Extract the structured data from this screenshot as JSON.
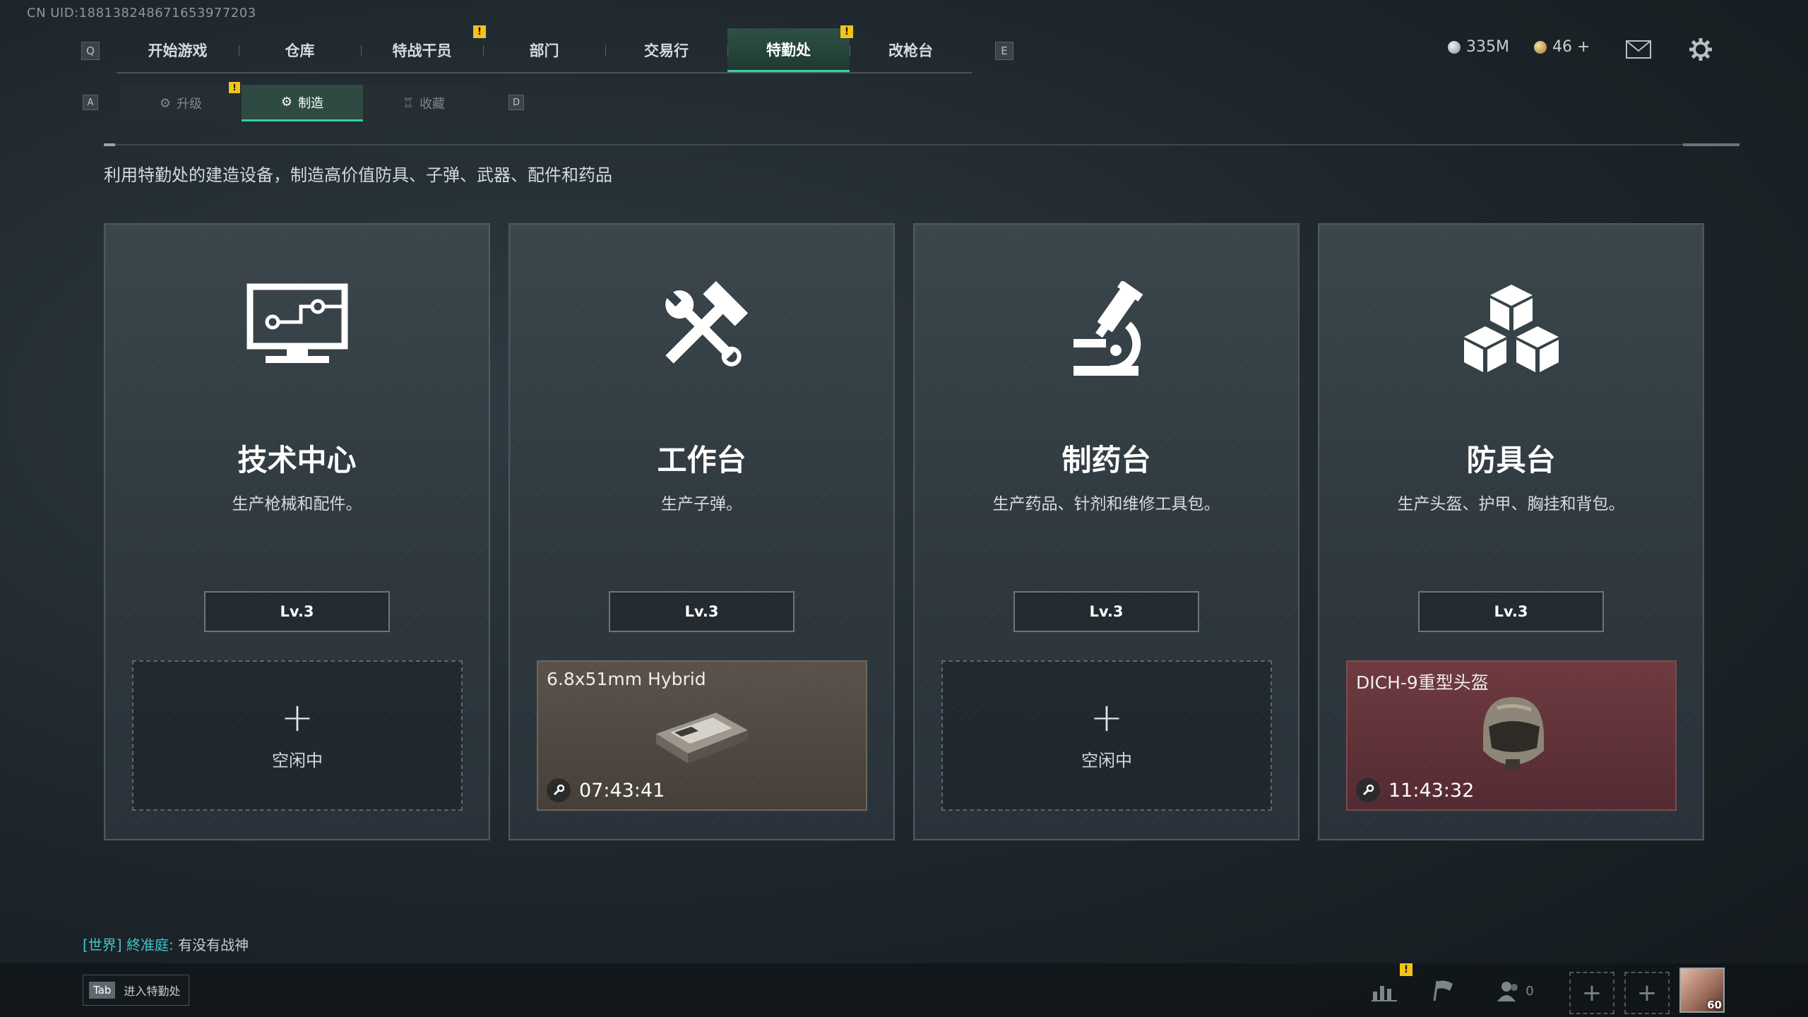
{
  "uid": "CN UID:188138248671653977203",
  "nav": {
    "left_key": "Q",
    "right_key": "E",
    "tabs": [
      {
        "label": "开始游戏"
      },
      {
        "label": "仓库"
      },
      {
        "label": "特战干员"
      },
      {
        "label": "部门"
      },
      {
        "label": "交易行"
      },
      {
        "label": "特勤处"
      },
      {
        "label": "改枪台"
      }
    ],
    "active_index": 5,
    "badges": [
      "!",
      "!"
    ]
  },
  "currency": {
    "balance": "335M",
    "coins": "46 +"
  },
  "subnav": {
    "left_key": "A",
    "right_key": "D",
    "tabs": [
      {
        "label": "升级"
      },
      {
        "label": "制造"
      },
      {
        "label": "收藏"
      }
    ],
    "active_index": 1,
    "badge": "!"
  },
  "description": "利用特勤处的建造设备，制造高价值防具、子弹、武器、配件和药品",
  "cards": [
    {
      "title": "技术中心",
      "subtitle": "生产枪械和配件。",
      "level": "Lv.3",
      "icon": "computer-icon",
      "slot": {
        "status": "idle",
        "plus": "+",
        "label": "空闲中"
      }
    },
    {
      "title": "工作台",
      "subtitle": "生产子弹。",
      "level": "Lv.3",
      "icon": "hammer-wrench-icon",
      "slot": {
        "status": "crafting",
        "item": "6.8x51mm Hybrid",
        "timer": "07:43:41"
      }
    },
    {
      "title": "制药台",
      "subtitle": "生产药品、针剂和维修工具包。",
      "level": "Lv.3",
      "icon": "microscope-icon",
      "slot": {
        "status": "idle",
        "plus": "+",
        "label": "空闲中"
      }
    },
    {
      "title": "防具台",
      "subtitle": "生产头盔、护甲、胸挂和背包。",
      "level": "Lv.3",
      "icon": "cubes-icon",
      "slot": {
        "status": "crafting",
        "item": "DICH-9重型头盔",
        "timer": "11:43:32"
      }
    }
  ],
  "chat": {
    "channel": "[世界]",
    "sender": "終准庭:",
    "message": "有没有战神"
  },
  "tab_hint": {
    "key": "Tab",
    "label": "进入特勤处"
  },
  "bottom": {
    "friends_count": "0",
    "stats_badge": "!",
    "add_slots": [
      "+",
      "+"
    ],
    "player_level": "60"
  },
  "colors": {
    "accent": "#35d196",
    "badge": "#f0c419",
    "slot_ammo": "#5a524a",
    "slot_helmet": "#6e3a40"
  }
}
